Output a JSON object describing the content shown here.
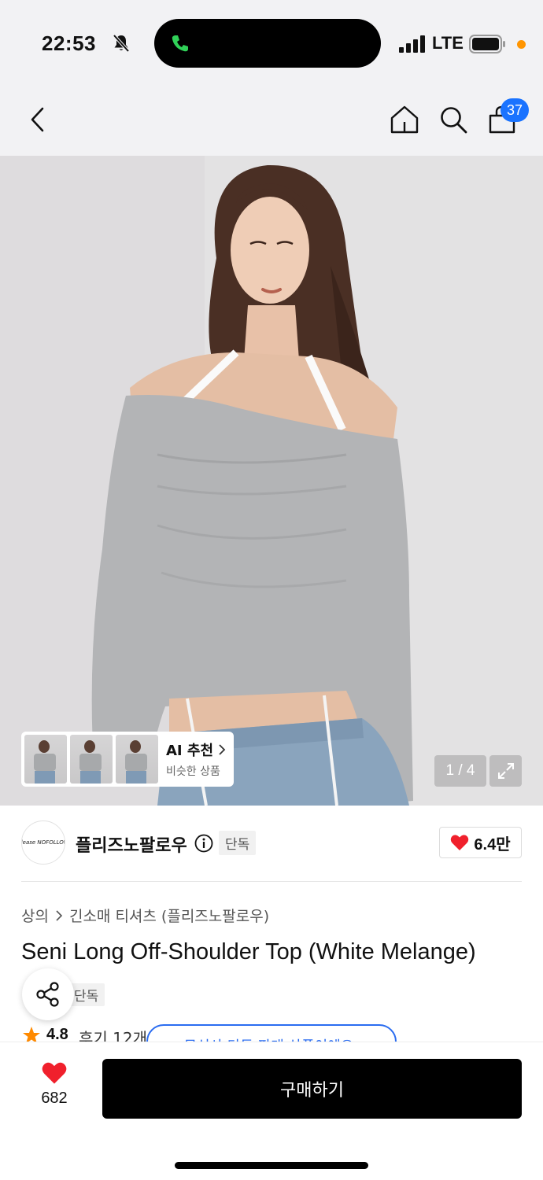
{
  "status_bar": {
    "time": "22:53",
    "network": "LTE"
  },
  "nav": {
    "cart_count": "37"
  },
  "gallery": {
    "page_indicator": "1 / 4",
    "ai_recommend": {
      "title": "AI 추천",
      "subtitle": "비슷한 상품"
    }
  },
  "brand": {
    "logo_text": "please NOFOLLOW",
    "name": "플리즈노팔로우",
    "exclusive_tag": "단독",
    "likes": "6.4만"
  },
  "product": {
    "breadcrumb": [
      "상의",
      "긴소매 티셔츠 (플리즈노팔로우)"
    ],
    "title": "Seni Long Off-Shoulder Top (White Melange)",
    "exclusive_tag": "단독",
    "rating": "4.8",
    "review_count": "후기 12개",
    "promo_text": "· 무신사 단독 판매 상품이에요"
  },
  "bottom_bar": {
    "wish_count": "682",
    "buy_label": "구매하기"
  },
  "colors": {
    "accent_blue": "#1a73ff",
    "heart_red": "#f0202c",
    "buy_button": "#000000",
    "star": "#ff8a00"
  }
}
